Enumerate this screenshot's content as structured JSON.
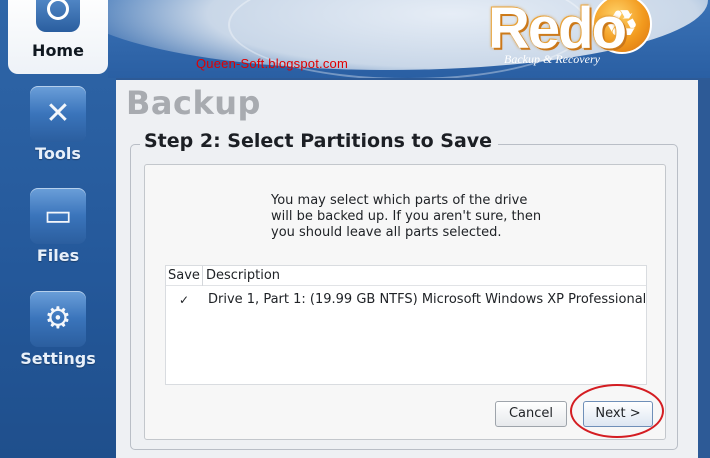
{
  "header": {
    "watermark": "Queen-Soft.blogspot.com",
    "logo": {
      "word": "Redo",
      "tagline": "Backup & Recovery"
    }
  },
  "sidebar": {
    "items": [
      {
        "label": "Home",
        "icon": "home-icon",
        "active": true
      },
      {
        "label": "Tools",
        "icon": "wrench-screwdriver-icon"
      },
      {
        "label": "Files",
        "icon": "folder-icon"
      },
      {
        "label": "Settings",
        "icon": "gears-icon"
      }
    ]
  },
  "main": {
    "page_title": "Backup",
    "step_title": "Step 2: Select Partitions to Save",
    "intro": "You may select which parts of the drive\nwill be backed up.  If you aren't sure, then\nyou should leave all parts selected.",
    "table": {
      "columns": [
        "Save",
        "Description"
      ],
      "rows": [
        {
          "checked": true,
          "description": "Drive 1, Part 1: (19.99 GB NTFS) Microsoft Windows XP Professional"
        }
      ]
    },
    "buttons": {
      "cancel": "Cancel",
      "next": "Next >"
    }
  },
  "colors": {
    "sidebar_blue": "#2f66a8",
    "highlight_red": "#d41d22",
    "title_gray": "#a8abb0"
  }
}
